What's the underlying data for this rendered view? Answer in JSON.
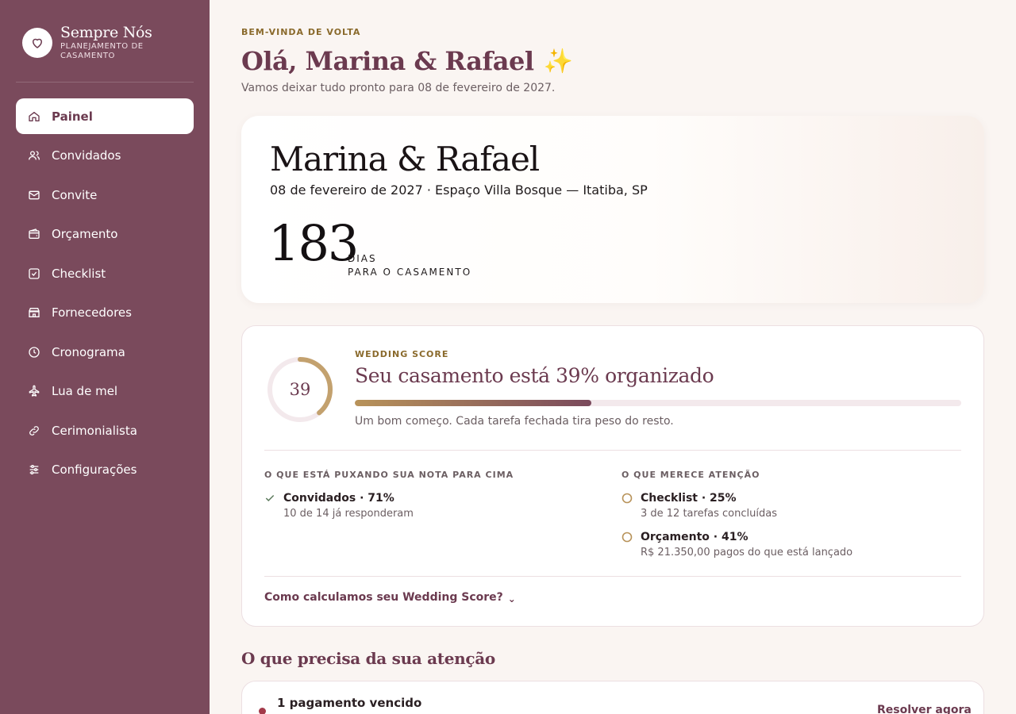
{
  "brand": {
    "name": "Sempre Nós",
    "subtitle": "PLANEJAMENTO DE CASAMENTO",
    "logo_icon": "heart-icon"
  },
  "nav": {
    "items": [
      {
        "label": "Painel",
        "icon": "home-icon",
        "active": true
      },
      {
        "label": "Convidados",
        "icon": "users-icon"
      },
      {
        "label": "Convite",
        "icon": "mail-icon"
      },
      {
        "label": "Orçamento",
        "icon": "wallet-icon"
      },
      {
        "label": "Checklist",
        "icon": "checkbox-icon"
      },
      {
        "label": "Fornecedores",
        "icon": "store-icon"
      },
      {
        "label": "Cronograma",
        "icon": "clock-icon"
      },
      {
        "label": "Lua de mel",
        "icon": "plane-icon"
      },
      {
        "label": "Cerimonialista",
        "icon": "link-icon"
      },
      {
        "label": "Configurações",
        "icon": "sliders-icon"
      }
    ]
  },
  "header": {
    "eyebrow": "BEM-VINDA DE VOLTA",
    "greeting": "Olá, Marina & Rafael",
    "sparkle": "✨",
    "subtitle": "Vamos deixar tudo pronto para 08 de fevereiro de 2027."
  },
  "hero": {
    "names": "Marina & Rafael",
    "details": "08 de fevereiro de 2027 · Espaço Villa Bosque — Itatiba, SP",
    "days": "183",
    "unit_line1": "DIAS",
    "unit_line2": "PARA O CASAMENTO"
  },
  "score": {
    "value": "39",
    "progress": 0.39,
    "label": "WEDDING SCORE",
    "title": "Seu casamento está 39% organizado",
    "note": "Um bom começo. Cada tarefa fechada tira peso do resto.",
    "positive_title": "O QUE ESTÁ PUXANDO SUA NOTA PARA CIMA",
    "positive_items": [
      {
        "title": "Convidados · 71%",
        "sub": "10 de 14 já responderam"
      }
    ],
    "attention_title": "O QUE MERECE ATENÇÃO",
    "attention_items": [
      {
        "title": "Checklist · 25%",
        "sub": "3 de 12 tarefas concluídas"
      },
      {
        "title": "Orçamento · 41%",
        "sub": "R$ 21.350,00 pagos do que está lançado"
      }
    ],
    "how_link": "Como calculamos seu Wedding Score?",
    "how_chevron": "⌄"
  },
  "attention_section": {
    "title": "O que precisa da sua atenção",
    "alert_title": "1 pagamento vencido",
    "alert_link": "Resolver agora →"
  },
  "colors": {
    "sidebar": "#7a4a5c",
    "accent": "#6b3a4f",
    "gold": "#b8935a",
    "alert": "#a33a4a",
    "background": "#faf5f2"
  }
}
